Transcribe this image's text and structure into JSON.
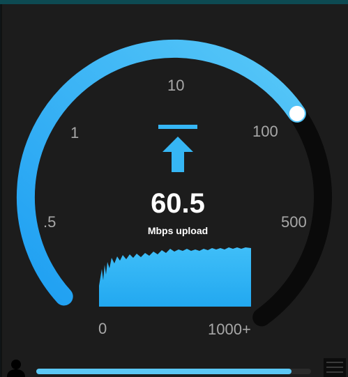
{
  "gauge": {
    "scale_labels": [
      "0",
      ".5",
      "1",
      "10",
      "100",
      "500",
      "1000+"
    ],
    "fill_fraction": 0.68,
    "colors": {
      "fill_start": "#1e9ff2",
      "fill_end": "#58c8f8",
      "track": "#0a0a0a",
      "knob": "#ffffff"
    }
  },
  "reading": {
    "value": "60.5",
    "unit": "Mbps upload",
    "direction_icon": "upload-arrow-icon"
  },
  "footer": {
    "progress_fraction": 0.93,
    "user_icon": "user-icon",
    "menu_icon": "menu-icon"
  }
}
